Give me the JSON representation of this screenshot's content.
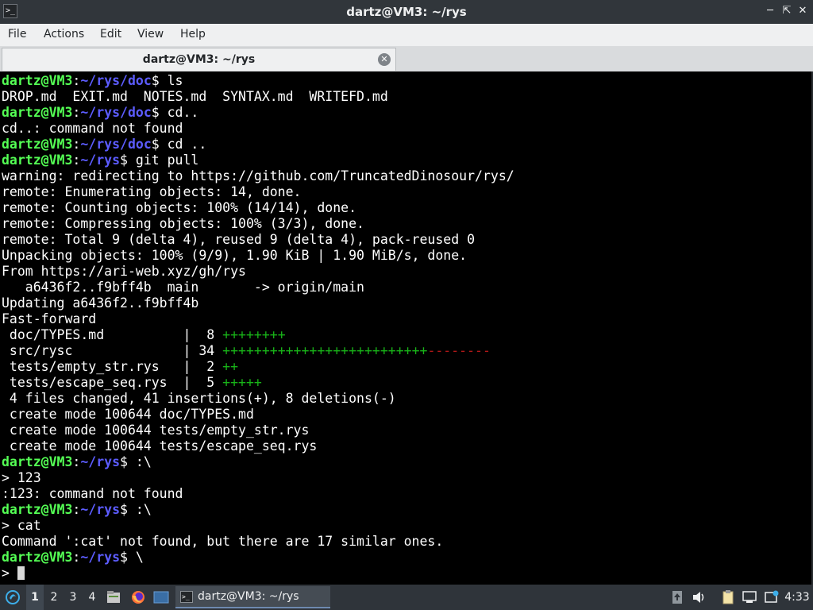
{
  "window": {
    "title": "dartz@VM3: ~/rys",
    "icon": "terminal-icon",
    "controls": [
      "minimize-icon",
      "maximize-icon",
      "close-icon"
    ]
  },
  "menu": [
    "File",
    "Actions",
    "Edit",
    "View",
    "Help"
  ],
  "tab": {
    "label": "dartz@VM3: ~/rys"
  },
  "colors": {
    "prompt_user": "#54ff54",
    "prompt_path": "#5c5cff",
    "diff_plus": "#18b218",
    "diff_minus": "#b21818",
    "terminal_bg": "#000000",
    "panel_bg": "#2f343a"
  },
  "terminal": {
    "lines": [
      [
        {
          "t": "dartz@VM3",
          "c": "pu"
        },
        {
          "t": ":"
        },
        {
          "t": "~/rys/doc",
          "c": "pp"
        },
        {
          "t": "$ ls"
        }
      ],
      [
        {
          "t": "DROP.md  EXIT.md  NOTES.md  SYNTAX.md  WRITEFD.md"
        }
      ],
      [
        {
          "t": "dartz@VM3",
          "c": "pu"
        },
        {
          "t": ":"
        },
        {
          "t": "~/rys/doc",
          "c": "pp"
        },
        {
          "t": "$ cd.."
        }
      ],
      [
        {
          "t": "cd..: command not found"
        }
      ],
      [
        {
          "t": "dartz@VM3",
          "c": "pu"
        },
        {
          "t": ":"
        },
        {
          "t": "~/rys/doc",
          "c": "pp"
        },
        {
          "t": "$ cd .."
        }
      ],
      [
        {
          "t": "dartz@VM3",
          "c": "pu"
        },
        {
          "t": ":"
        },
        {
          "t": "~/rys",
          "c": "pp"
        },
        {
          "t": "$ git pull"
        }
      ],
      [
        {
          "t": "warning: redirecting to https://github.com/TruncatedDinosour/rys/"
        }
      ],
      [
        {
          "t": "remote: Enumerating objects: 14, done."
        }
      ],
      [
        {
          "t": "remote: Counting objects: 100% (14/14), done."
        }
      ],
      [
        {
          "t": "remote: Compressing objects: 100% (3/3), done."
        }
      ],
      [
        {
          "t": "remote: Total 9 (delta 4), reused 9 (delta 4), pack-reused 0"
        }
      ],
      [
        {
          "t": "Unpacking objects: 100% (9/9), 1.90 KiB | 1.90 MiB/s, done."
        }
      ],
      [
        {
          "t": "From https://ari-web.xyz/gh/rys"
        }
      ],
      [
        {
          "t": "   a6436f2..f9bff4b  main       -> origin/main"
        }
      ],
      [
        {
          "t": "Updating a6436f2..f9bff4b"
        }
      ],
      [
        {
          "t": "Fast-forward"
        }
      ],
      [
        {
          "t": " doc/TYPES.md          |  8 "
        },
        {
          "t": "++++++++",
          "c": "plus"
        }
      ],
      [
        {
          "t": " src/rysc              | 34 "
        },
        {
          "t": "++++++++++++++++++++++++++",
          "c": "plus"
        },
        {
          "t": "--------",
          "c": "minus"
        }
      ],
      [
        {
          "t": " tests/empty_str.rys   |  2 "
        },
        {
          "t": "++",
          "c": "plus"
        }
      ],
      [
        {
          "t": " tests/escape_seq.rys  |  5 "
        },
        {
          "t": "+++++",
          "c": "plus"
        }
      ],
      [
        {
          "t": " 4 files changed, 41 insertions(+), 8 deletions(-)"
        }
      ],
      [
        {
          "t": " create mode 100644 doc/TYPES.md"
        }
      ],
      [
        {
          "t": " create mode 100644 tests/empty_str.rys"
        }
      ],
      [
        {
          "t": " create mode 100644 tests/escape_seq.rys"
        }
      ],
      [
        {
          "t": "dartz@VM3",
          "c": "pu"
        },
        {
          "t": ":"
        },
        {
          "t": "~/rys",
          "c": "pp"
        },
        {
          "t": "$ :\\"
        }
      ],
      [
        {
          "t": "> 123"
        }
      ],
      [
        {
          "t": ":123: command not found"
        }
      ],
      [
        {
          "t": "dartz@VM3",
          "c": "pu"
        },
        {
          "t": ":"
        },
        {
          "t": "~/rys",
          "c": "pp"
        },
        {
          "t": "$ :\\"
        }
      ],
      [
        {
          "t": "> cat"
        }
      ],
      [
        {
          "t": "Command ':cat' not found, but there are 17 similar ones."
        }
      ],
      [
        {
          "t": "dartz@VM3",
          "c": "pu"
        },
        {
          "t": ":"
        },
        {
          "t": "~/rys",
          "c": "pp"
        },
        {
          "t": "$ \\"
        }
      ],
      [
        {
          "t": "> "
        },
        {
          "cursor": true
        }
      ]
    ]
  },
  "taskbar": {
    "workspaces": [
      "1",
      "2",
      "3",
      "4"
    ],
    "active_workspace": "1",
    "task_label": "dartz@VM3: ~/rys",
    "clock": "4:33",
    "launcher_icons": [
      "start-menu-icon",
      "file-manager-icon",
      "firefox-icon",
      "show-desktop-icon"
    ],
    "tray_icons": [
      "update-icon",
      "volume-icon",
      "clipboard-icon",
      "network-icon",
      "notification-icon"
    ]
  }
}
